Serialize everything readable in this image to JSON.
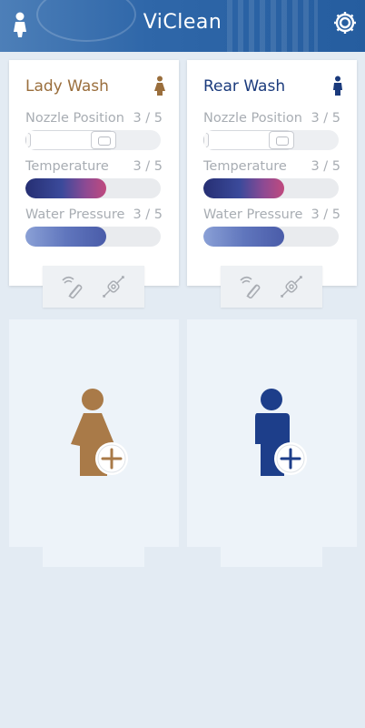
{
  "header": {
    "title": "ViClean"
  },
  "cards": [
    {
      "title": "Lady Wash",
      "accent": "#9a6e3c",
      "nozzle": {
        "label": "Nozzle Position",
        "value": "3 / 5"
      },
      "temperature": {
        "label": "Temperature",
        "value": "3 / 5"
      },
      "pressure": {
        "label": "Water Pressure",
        "value": "3 / 5"
      }
    },
    {
      "title": "Rear Wash",
      "accent": "#1a3a7c",
      "nozzle": {
        "label": "Nozzle Position",
        "value": "3 / 5"
      },
      "temperature": {
        "label": "Temperature",
        "value": "3 / 5"
      },
      "pressure": {
        "label": "Water Pressure",
        "value": "3 / 5"
      }
    }
  ],
  "panels": [
    {
      "icon": "add-lady-profile-icon",
      "color": "#a97a48"
    },
    {
      "icon": "add-man-profile-icon",
      "color": "#1d3e8a"
    }
  ],
  "levels": {
    "nozzle": 0.6,
    "temperature": 0.6,
    "pressure": 0.6
  },
  "icons": {
    "user": "person-icon",
    "settings": "gear-icon",
    "remote": "remote-control-icon",
    "toilet": "toilet-connect-icon"
  }
}
